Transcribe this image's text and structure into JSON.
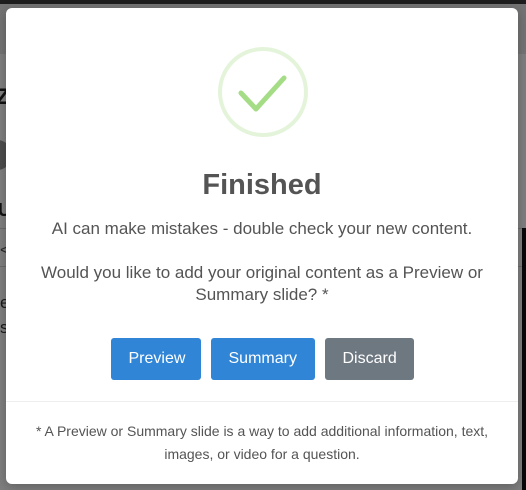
{
  "background": {
    "fragment_1": "Z",
    "fragment_2": "U",
    "fragment_3": "<",
    "fragment_4": "e",
    "fragment_5": "s"
  },
  "dialog": {
    "icon": "success-checkmark-icon",
    "title": "Finished",
    "message_line_1": "AI can make mistakes - double check your new content.",
    "message_line_2": "Would you like to add your original content as a Preview or Summary slide? *",
    "buttons": {
      "preview": "Preview",
      "summary": "Summary",
      "discard": "Discard"
    },
    "footer_note": "* A Preview or Summary slide is a way to add additional information, text, images, or video for a question."
  },
  "colors": {
    "primary_button": "#3085d6",
    "secondary_button": "#6e7881",
    "success_icon": "#a5dc86",
    "text": "#545454"
  }
}
